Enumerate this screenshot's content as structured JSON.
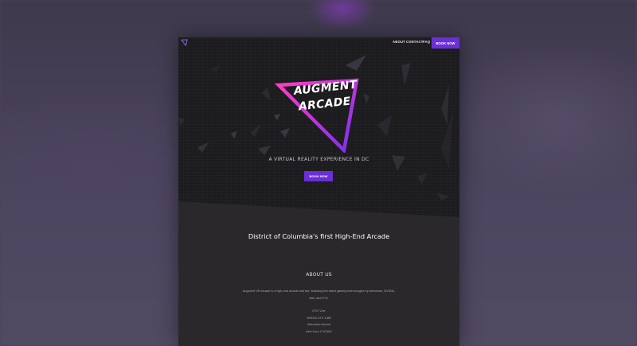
{
  "nav": {
    "links": [
      "ABOUT",
      "CONTACT",
      "FAQ"
    ],
    "book_label": "BOOK NOW"
  },
  "hero": {
    "logo_line1": "AUGMENT",
    "logo_line2": "ARCADE",
    "tagline": "A VIRTUAL REALITY EXPERIENCE IN DC",
    "book_label": "BOOK NOW"
  },
  "section": {
    "headline": "District of Columbia's first High-End Arcade"
  },
  "about": {
    "title": "ABOUT US",
    "text": "Augment VR Arcade is a high-end arcade and bar, featuring the latest gaming technologies by Alienware, NVIDIA, Intel, and HTC.",
    "specs": [
      "HTC Vive",
      "NVIDIA GTX 1080",
      "Alienware Aurora",
      "Intel Core i7 6700K"
    ]
  },
  "colors": {
    "accent_purple": "#6a2fd6",
    "gradient_pink": "#ff3fbf",
    "gradient_violet": "#7a2ff0",
    "page_bg": "#2a282b",
    "hero_bg": "#1c1b1e"
  },
  "icons": {
    "logo_mark": "triangle-logo-icon"
  }
}
